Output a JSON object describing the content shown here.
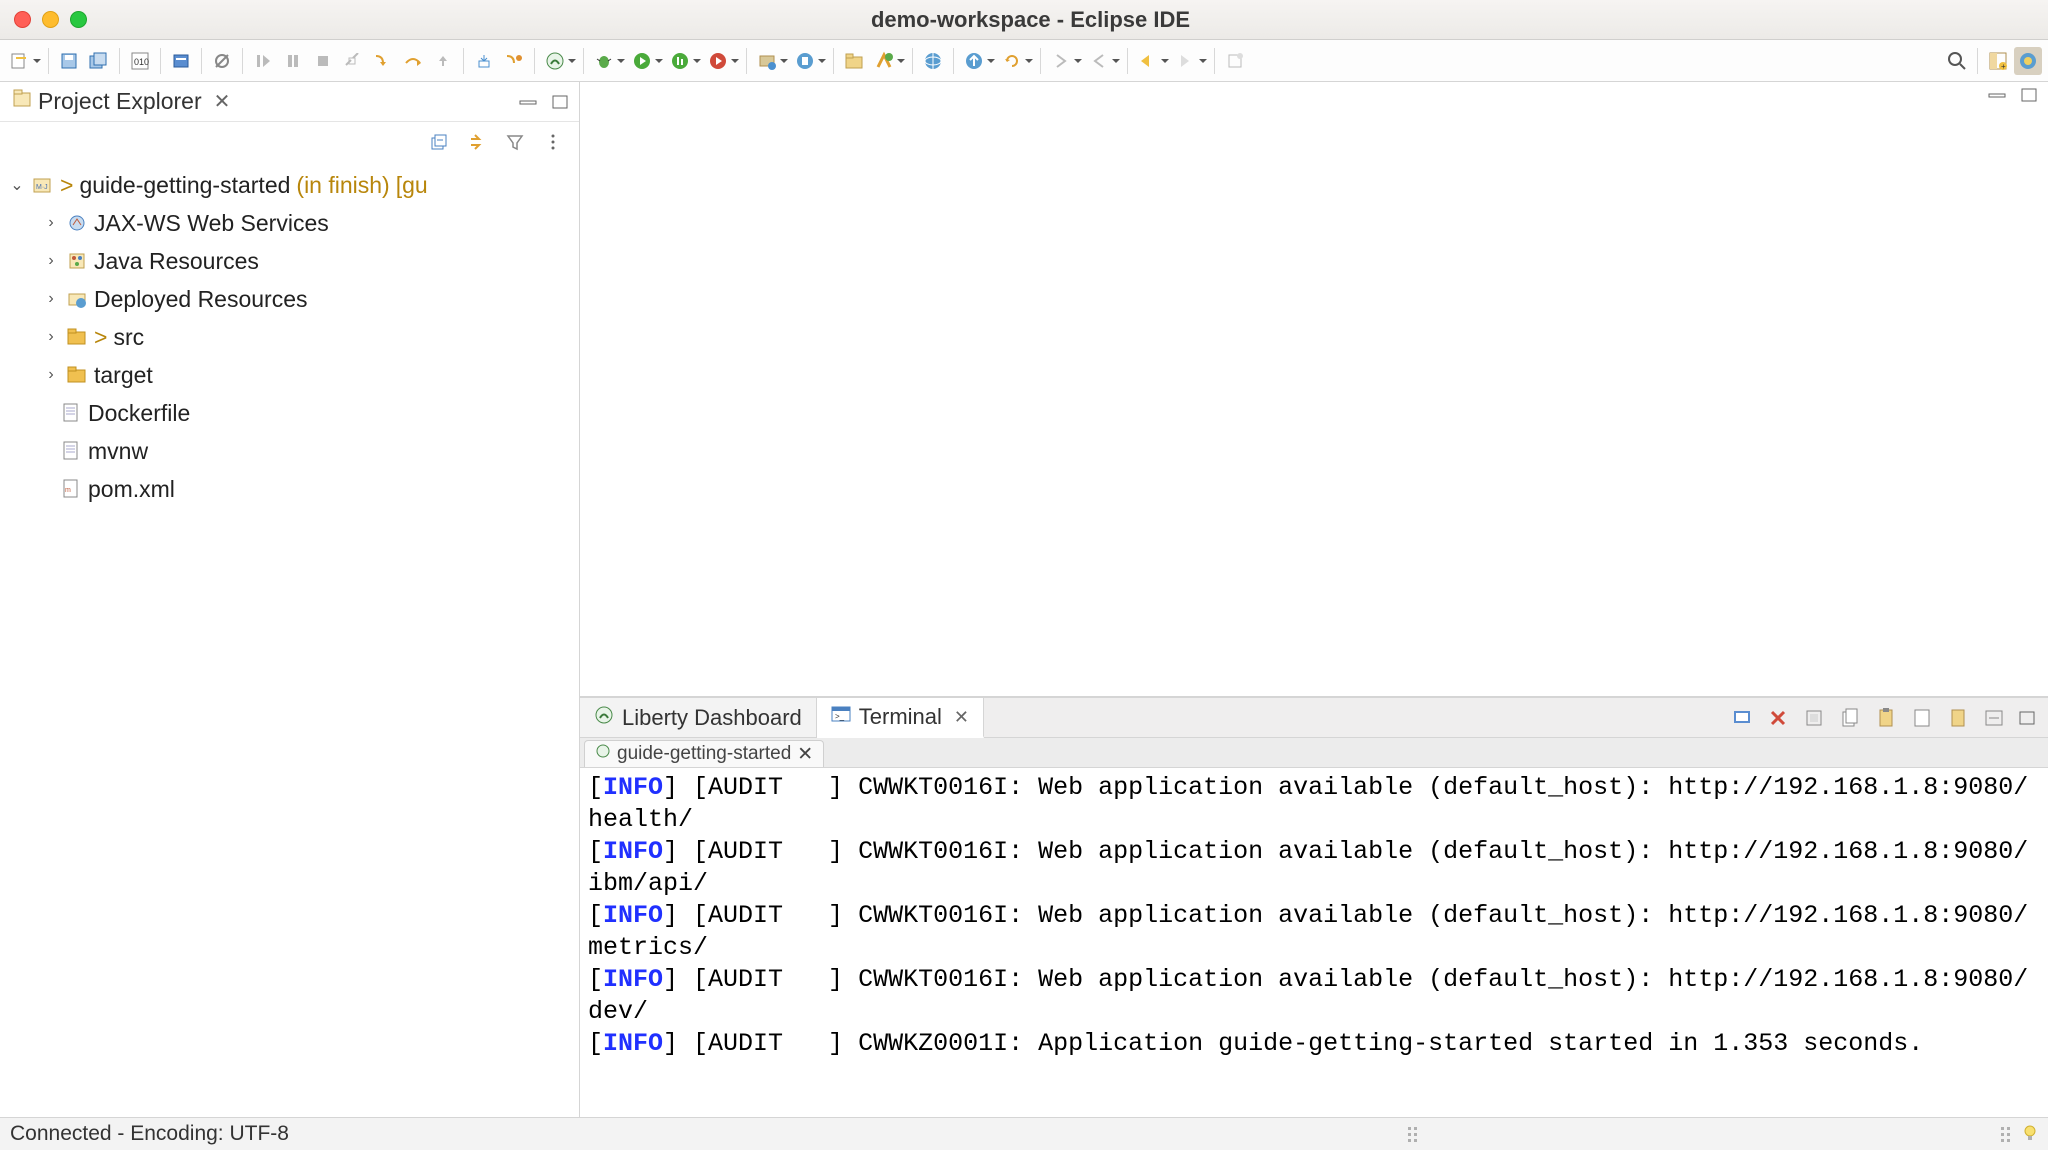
{
  "window": {
    "title": "demo-workspace - Eclipse IDE"
  },
  "projectExplorer": {
    "title": "Project Explorer",
    "root": {
      "marker": ">",
      "name": "guide-getting-started",
      "suffix": "(in finish)",
      "suffix2": "[gu"
    },
    "children": [
      {
        "label": "JAX-WS Web Services",
        "expandable": true,
        "icon": "webservice"
      },
      {
        "label": "Java Resources",
        "expandable": true,
        "icon": "javares"
      },
      {
        "label": "Deployed Resources",
        "expandable": true,
        "icon": "deployed"
      },
      {
        "label": "src",
        "expandable": true,
        "icon": "folder",
        "marker": ">"
      },
      {
        "label": "target",
        "expandable": true,
        "icon": "folder"
      },
      {
        "label": "Dockerfile",
        "expandable": false,
        "icon": "file"
      },
      {
        "label": "mvnw",
        "expandable": false,
        "icon": "file"
      },
      {
        "label": "pom.xml",
        "expandable": false,
        "icon": "xmlfile"
      }
    ]
  },
  "bottomTabs": {
    "liberty": "Liberty Dashboard",
    "terminal": "Terminal"
  },
  "terminalTab": {
    "label": "guide-getting-started"
  },
  "terminalLines": [
    {
      "prefix": "[",
      "level": "INFO",
      "rest": "] [AUDIT   ] CWWKT0016I: Web application available (default_host): http://192.168.1.8:9080/health/"
    },
    {
      "prefix": "[",
      "level": "INFO",
      "rest": "] [AUDIT   ] CWWKT0016I: Web application available (default_host): http://192.168.1.8:9080/ibm/api/"
    },
    {
      "prefix": "[",
      "level": "INFO",
      "rest": "] [AUDIT   ] CWWKT0016I: Web application available (default_host): http://192.168.1.8:9080/metrics/"
    },
    {
      "prefix": "[",
      "level": "INFO",
      "rest": "] [AUDIT   ] CWWKT0016I: Web application available (default_host): http://192.168.1.8:9080/dev/"
    },
    {
      "prefix": "[",
      "level": "INFO",
      "rest": "] [AUDIT   ] CWWKZ0001I: Application guide-getting-started started in 1.353 seconds."
    }
  ],
  "statusbar": {
    "text": "Connected - Encoding: UTF-8"
  }
}
